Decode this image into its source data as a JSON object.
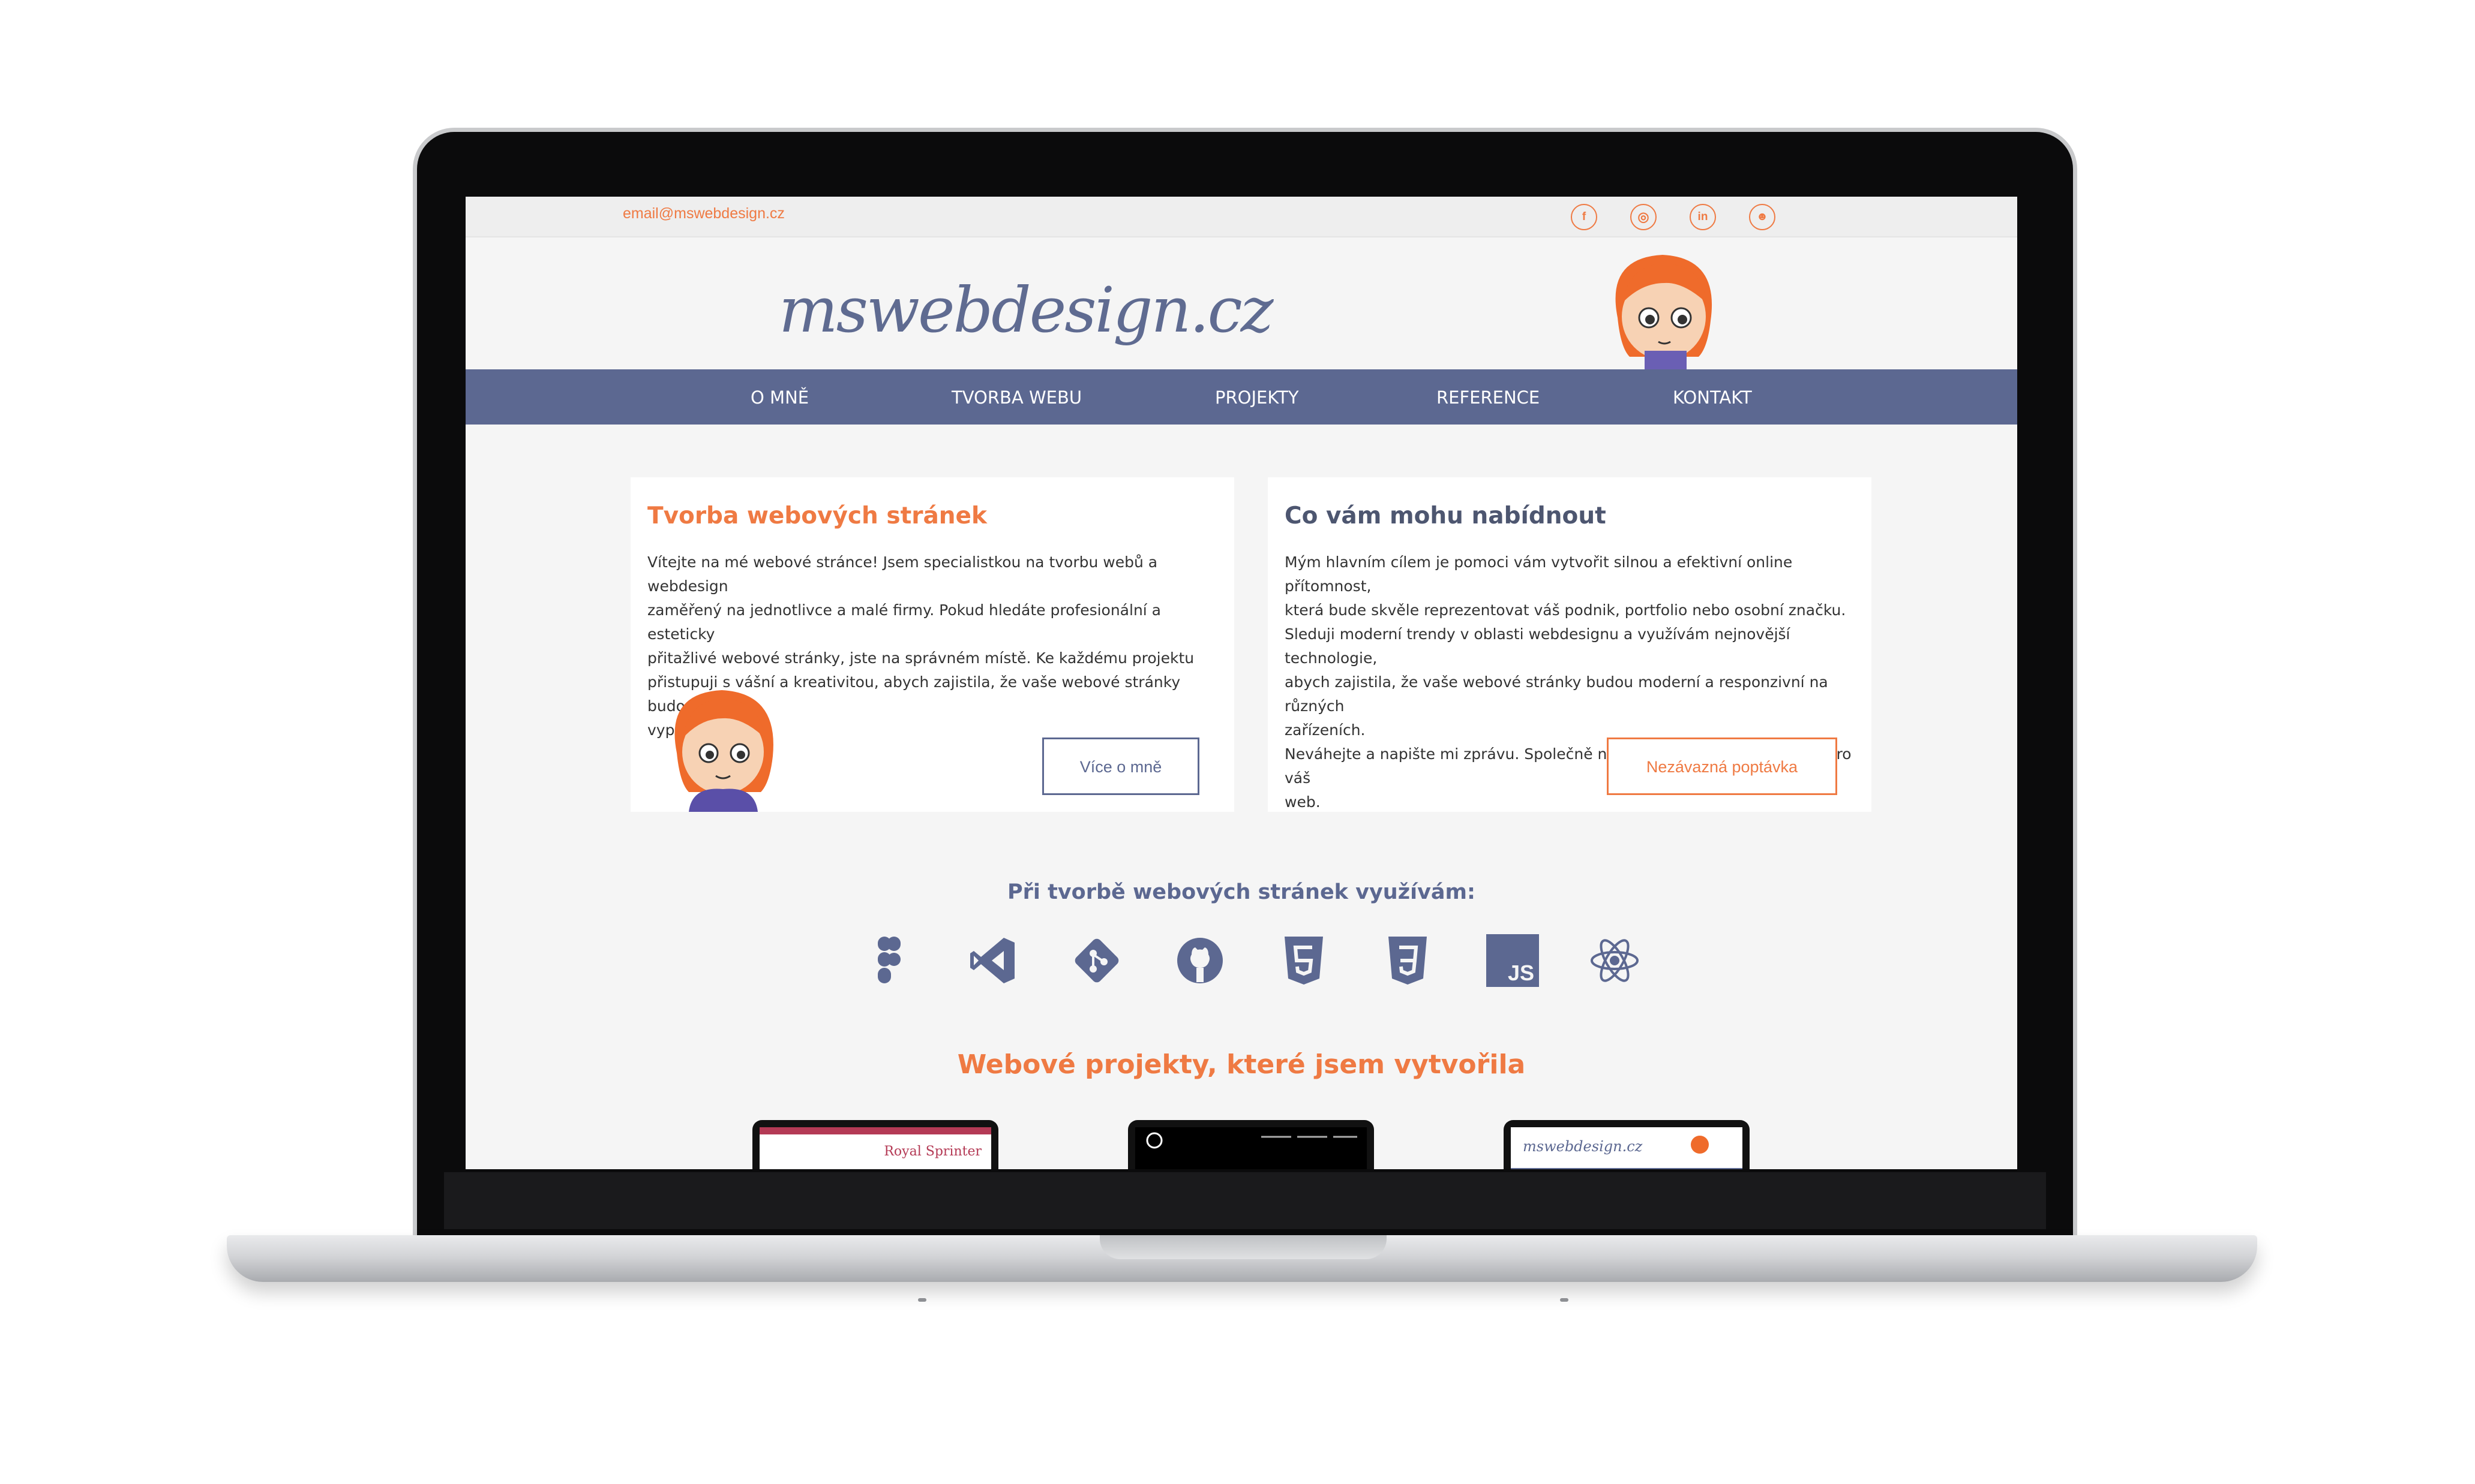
{
  "site": {
    "email": "email@mswebdesign.cz",
    "logo": "mswebdesign.cz",
    "social": [
      {
        "icon": "facebook-icon",
        "glyph": "f"
      },
      {
        "icon": "instagram-icon",
        "glyph": "◎"
      },
      {
        "icon": "linkedin-icon",
        "glyph": "in"
      },
      {
        "icon": "github-icon",
        "glyph": "☻"
      }
    ]
  },
  "nav": [
    "O MNĚ",
    "TVORBA WEBU",
    "PROJEKTY",
    "REFERENCE",
    "KONTAKT"
  ],
  "cards": [
    {
      "title": "Tvorba webových stránek",
      "text": "Vítejte na mé webové stránce! Jsem specialistkou na tvorbu webů a webdesign\nzaměřený na jednotlivce a malé firmy. Pokud hledáte profesionální a esteticky\npřitažlivé webové stránky, jste na správném místě. Ke každému projektu\npřistupuji s vášní a kreativitou, abych zajistila, že vaše webové stránky budou\nvypadat úžasně.",
      "button": "Více o mně"
    },
    {
      "title": "Co vám mohu nabídnout",
      "text": "Mým hlavním cílem je pomoci vám vytvořit silnou a efektivní online přítomnost,\nkterá bude skvěle reprezentovat váš podnik, portfolio nebo osobní značku.\nSleduji moderní trendy v oblasti webdesignu a využívám nejnovější technologie,\nabych zajistila, že vaše webové stránky budou moderní a responzivní na různých\nzařízeních.\nNeváhejte a napište mi zprávu. Společně najdeme nejvýhodnější řešení pro váš\nweb.",
      "button": "Nezávazná poptávka"
    }
  ],
  "tools": {
    "title": "Při tvorbě webových stránek využívám:",
    "items": [
      "figma-icon",
      "vscode-icon",
      "git-icon",
      "github-icon",
      "html5-icon",
      "css3-icon",
      "javascript-icon",
      "react-icon"
    ],
    "js_label": "JS"
  },
  "projects": {
    "title": "Webové projekty, které jsem vytvořila",
    "thumb1_label": "Royal Sprinter"
  },
  "colors": {
    "accent": "#ef7a43",
    "nav": "#5c6891",
    "text": "#333333"
  }
}
